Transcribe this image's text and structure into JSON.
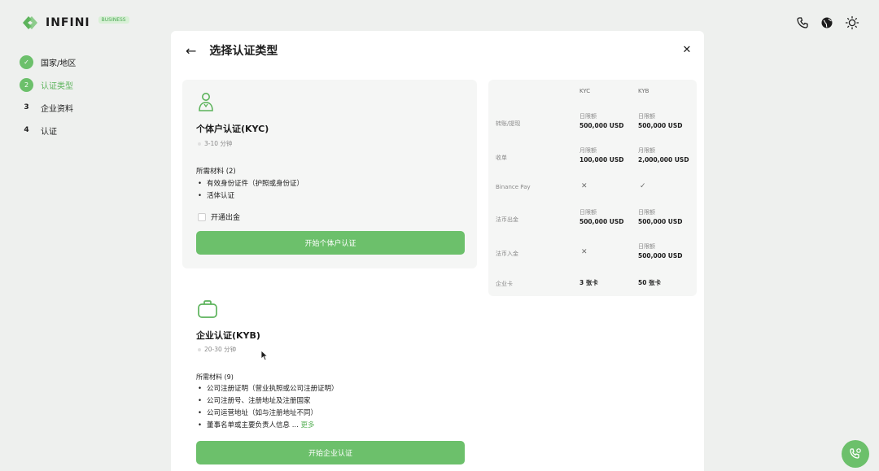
{
  "brand": {
    "name": "INFINI",
    "badge": "BUSINESS"
  },
  "steps": [
    {
      "num": "✓",
      "label": "国家/地区",
      "state": "done"
    },
    {
      "num": "2",
      "label": "认证类型",
      "state": "active"
    },
    {
      "num": "3",
      "label": "企业资料",
      "state": "todo"
    },
    {
      "num": "4",
      "label": "认证",
      "state": "todo"
    }
  ],
  "panel": {
    "title": "选择认证类型",
    "back_icon": "←",
    "close_icon": "✕"
  },
  "kyc": {
    "title": "个体户认证(KYC)",
    "time": "3-10 分钟",
    "req_title": "所需材料 (2)",
    "items": [
      "有效身份证件（护照或身份证）",
      "活体认证"
    ],
    "checkbox_label": "开通出金",
    "button": "开始个体户认证"
  },
  "kyb": {
    "title": "企业认证(KYB)",
    "time": "20-30 分钟",
    "req_title": "所需材料 (9)",
    "items": [
      "公司注册证明（营业执照或公司注册证明）",
      "公司注册号、注册地址及注册国家",
      "公司运营地址（如与注册地址不同）",
      "董事名单或主要负责人信息 ..."
    ],
    "more": "更多",
    "button": "开始企业认证"
  },
  "compare": {
    "col_kyc": "KYC",
    "col_kyb": "KYB",
    "rows": [
      {
        "label": "转账/提现",
        "kyc_sub": "日限额",
        "kyc_val": "500,000 USD",
        "kyb_sub": "日限额",
        "kyb_val": "500,000 USD"
      },
      {
        "label": "收单",
        "kyc_sub": "月限额",
        "kyc_val": "100,000 USD",
        "kyb_sub": "月限额",
        "kyb_val": "2,000,000 USD"
      },
      {
        "label": "Binance Pay",
        "kyc_mark": "✕",
        "kyb_mark": "✓"
      },
      {
        "label": "法币出金",
        "kyc_sub": "日限额",
        "kyc_val": "500,000 USD",
        "kyb_sub": "日限额",
        "kyb_val": "500,000 USD"
      },
      {
        "label": "法币入金",
        "kyc_mark": "✕",
        "kyb_sub": "日限额",
        "kyb_val": "500,000 USD"
      },
      {
        "label": "企业卡",
        "kyc_val": "3 张卡",
        "kyb_val": "50 张卡"
      }
    ]
  },
  "colors": {
    "accent": "#6cc06b",
    "panel_bg": "#ffffff",
    "page_bg": "#eef0ee"
  }
}
